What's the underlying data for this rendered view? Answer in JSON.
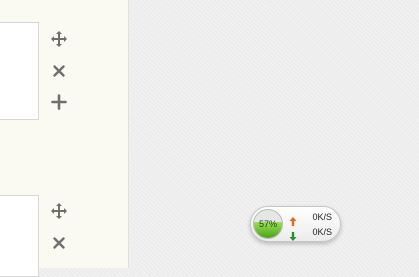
{
  "toolbar_top": {
    "icons": [
      "move-icon",
      "close-icon",
      "add-icon"
    ]
  },
  "toolbar_bottom": {
    "icons": [
      "move-icon",
      "close-icon"
    ]
  },
  "network_widget": {
    "usage_label": "57%",
    "usage_fraction": 0.57,
    "upload_speed": "0K/S",
    "download_speed": "0K/S",
    "accent_green": "#7cc93a",
    "upload_arrow_color": "#e06a1c",
    "download_arrow_color": "#2d8a2d"
  }
}
